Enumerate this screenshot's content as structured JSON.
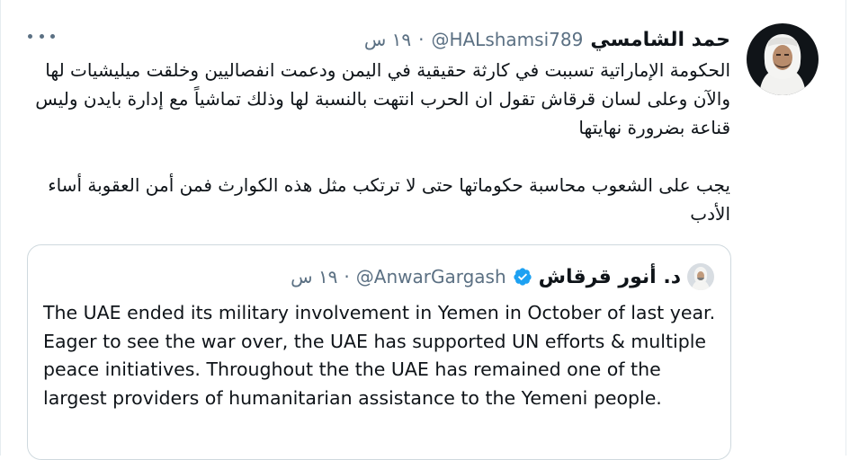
{
  "tweet": {
    "author_name": "حمد الشامسي",
    "handle": "@HALshamsi789",
    "separator": "·",
    "time": "١٩ س",
    "paragraphs": [
      "الحكومة الإماراتية تسببت في كارثة حقيقية في اليمن ودعمت انفصاليين وخلقت ميليشيات لها والآن وعلى لسان قرقاش تقول ان الحرب انتهت بالنسبة لها وذلك تماشياً مع إدارة بايدن وليس قناعة بضرورة نهايتها",
      "يجب على الشعوب محاسبة حكوماتها حتى لا ترتكب مثل هذه الكوارث فمن أمن العقوبة أساء الأدب"
    ]
  },
  "quoted_tweet": {
    "author_name": "د. أنور قرقاش",
    "handle": "@AnwarGargash",
    "separator": "·",
    "time": "١٩ س",
    "text": "The UAE ended its military involvement in Yemen in October of last year.  Eager to see the war over, the UAE has supported UN efforts & multiple peace initiatives. Throughout the the UAE has remained one of the largest providers of humanitarian assistance to the Yemeni people."
  },
  "icons": {
    "more": "more-options-icon",
    "verified": "verified-badge-icon"
  },
  "colors": {
    "secondary_text": "#5b7083",
    "verified_blue": "#1da1f2",
    "border": "#cfd9de"
  }
}
